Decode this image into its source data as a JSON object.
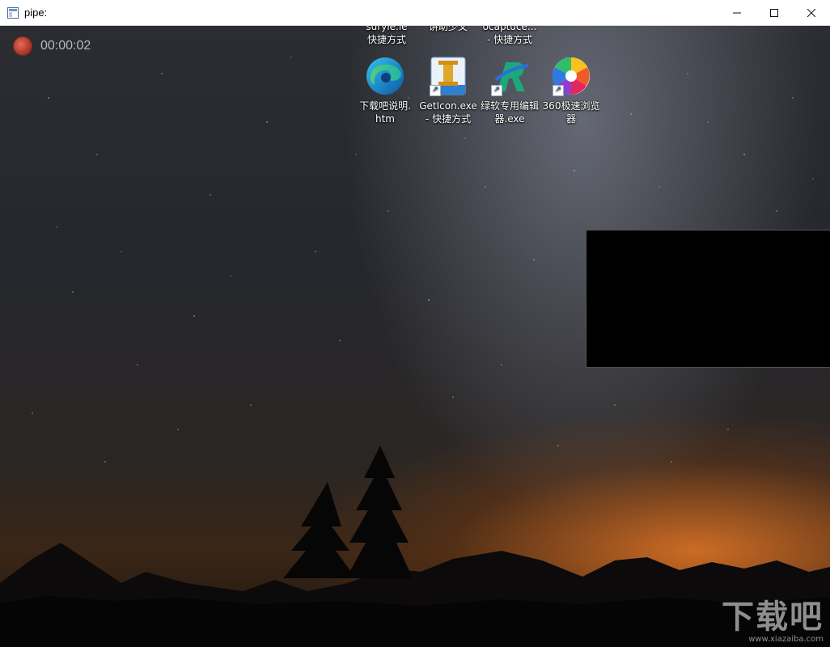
{
  "window": {
    "title": "pipe:",
    "controls": {
      "minimize": "—",
      "maximize": "☐",
      "close": "✕"
    }
  },
  "recording": {
    "elapsed": "00:00:02"
  },
  "desktop": {
    "partial_labels": [
      {
        "text": "快捷方式",
        "top": "suryle.le"
      },
      {
        "text": "",
        "top": "讲助少文"
      },
      {
        "text": "- 快捷方式",
        "top": "ocaptuce..."
      }
    ],
    "icons": [
      {
        "label_line1": "下载吧说明.",
        "label_line2": "htm",
        "icon": "edge-icon"
      },
      {
        "label_line1": "GetIcon.exe",
        "label_line2": "- 快捷方式",
        "icon": "geticon-icon"
      },
      {
        "label_line1": "绿软专用编辑",
        "label_line2": "器.exe",
        "icon": "editor-r-icon"
      },
      {
        "label_line1": "360极速浏览",
        "label_line2": "器",
        "icon": "browser-360-icon"
      }
    ]
  },
  "watermark": {
    "logo": "下载吧",
    "url": "www.xiazaiba.com"
  }
}
